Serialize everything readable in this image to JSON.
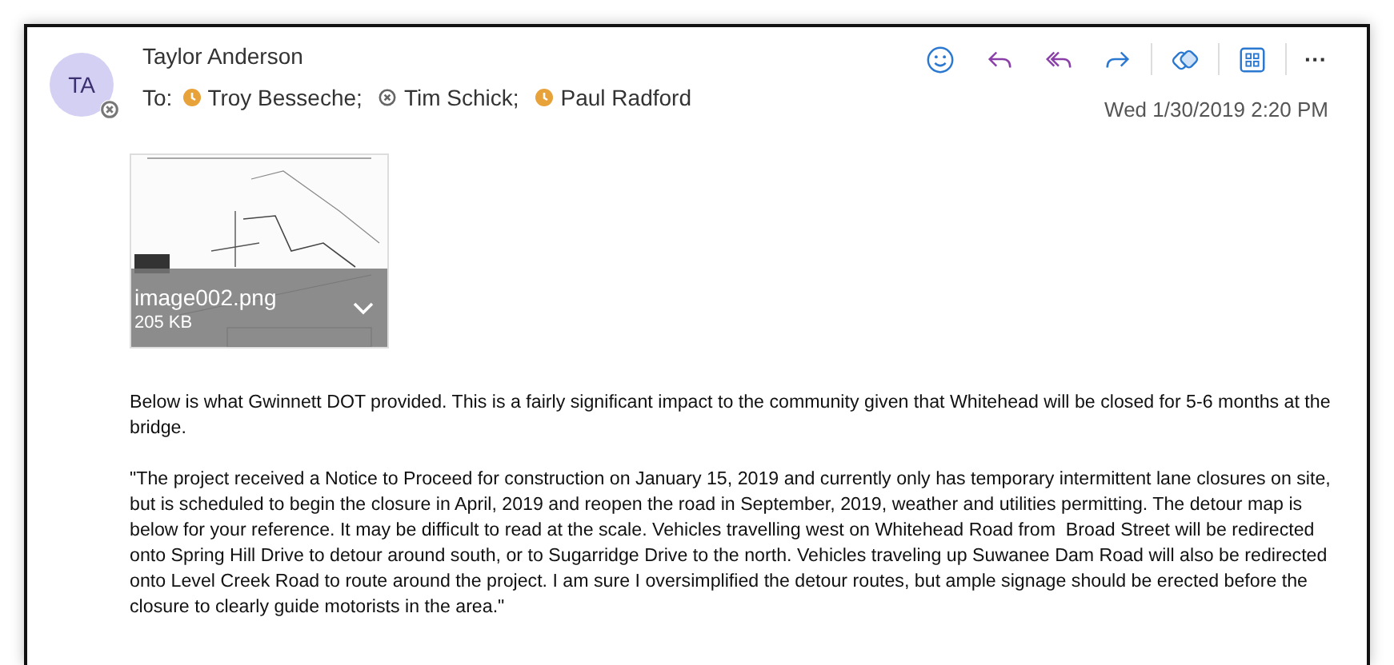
{
  "sender": {
    "initials": "TA",
    "name": "Taylor Anderson",
    "kind": "offline"
  },
  "to_label": "To:",
  "recipients": [
    {
      "name": "Troy Besseche;",
      "kind": "away"
    },
    {
      "name": "Tim Schick;",
      "kind": "offline"
    },
    {
      "name": "Paul Radford",
      "kind": "away"
    }
  ],
  "toolbar": [
    {
      "kind": "emoji"
    },
    {
      "kind": "reply"
    },
    {
      "kind": "reply-all"
    },
    {
      "kind": "forward"
    },
    {
      "kind": "divider"
    },
    {
      "kind": "tag"
    },
    {
      "kind": "divider"
    },
    {
      "kind": "apps"
    },
    {
      "kind": "divider"
    },
    {
      "kind": "more",
      "label": "···"
    }
  ],
  "date": "Wed 1/30/2019 2:20 PM",
  "attachment": {
    "kind": "picture",
    "filename": "image002.png",
    "size": "205 KB"
  },
  "body": [
    "Below is what Gwinnett DOT provided. This is a fairly significant impact to the community given that Whitehead will be closed for 5-6 months at the bridge.",
    "\"The project received a Notice to Proceed for construction on January 15, 2019 and currently only has temporary intermittent lane closures on site, but is scheduled to begin the closure in April, 2019 and reopen the road in September, 2019, weather and utilities permitting. The detour map is below for your reference. It may be difficult to read at the scale. Vehicles travelling west on Whitehead Road from  Broad Street will be redirected onto Spring Hill Drive to detour around south, or to Sugarridge Drive to the north. Vehicles traveling up Suwanee Dam Road will also be redirected onto Level Creek Road to route around the project. I am sure I oversimplified the detour routes, but ample signage should be erected before the closure to clearly guide motorists in the area.\""
  ]
}
